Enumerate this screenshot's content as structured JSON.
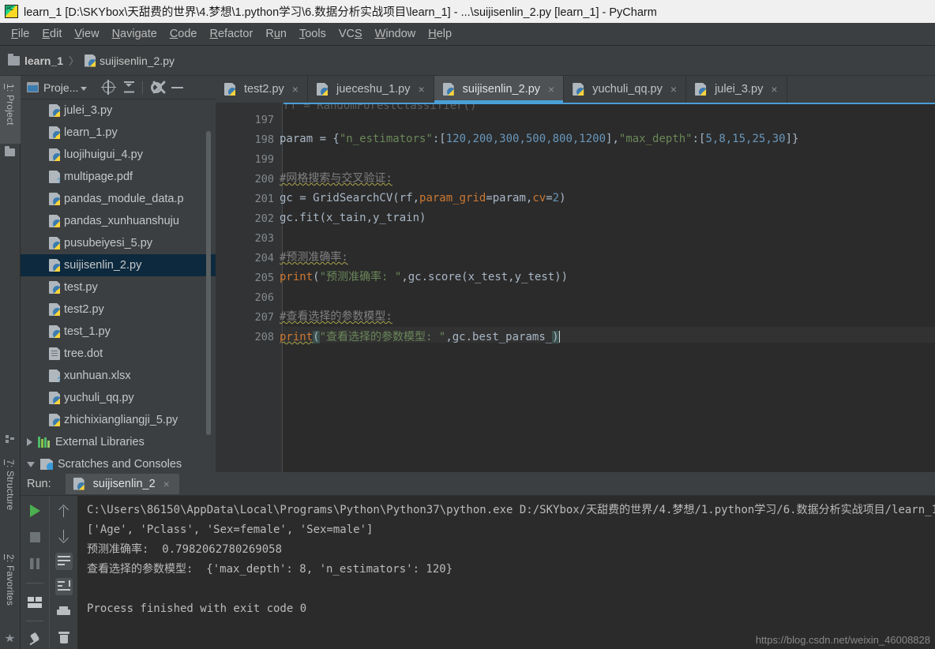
{
  "window": {
    "title": "learn_1 [D:\\SKYbox\\天甜费的世界\\4.梦想\\1.python学习\\6.数据分析实战项目\\learn_1] - ...\\suijisenlin_2.py [learn_1] - PyCharm",
    "logo_icon": "pycharm-logo-icon"
  },
  "menubar": {
    "items": [
      {
        "label": "File",
        "mnemonic": "F"
      },
      {
        "label": "Edit",
        "mnemonic": "E"
      },
      {
        "label": "View",
        "mnemonic": "V"
      },
      {
        "label": "Navigate",
        "mnemonic": "N"
      },
      {
        "label": "Code",
        "mnemonic": "C"
      },
      {
        "label": "Refactor",
        "mnemonic": "R"
      },
      {
        "label": "Run",
        "mnemonic": "u"
      },
      {
        "label": "Tools",
        "mnemonic": "T"
      },
      {
        "label": "VCS",
        "mnemonic": "S"
      },
      {
        "label": "Window",
        "mnemonic": "W"
      },
      {
        "label": "Help",
        "mnemonic": "H"
      }
    ]
  },
  "breadcrumb": {
    "separator": "〉",
    "items": [
      {
        "label": "learn_1",
        "icon": "folder-icon"
      },
      {
        "label": "suijisenlin_2.py",
        "icon": "python-file-icon"
      }
    ]
  },
  "left_strip": {
    "tabs": [
      {
        "label": "1: Project",
        "num": "1",
        "icon": "folder-icon",
        "active": true
      },
      {
        "label": "7: Structure",
        "num": "7",
        "icon": "structure-icon",
        "active": false
      },
      {
        "label": "2: Favorites",
        "num": "2",
        "icon": "star-icon",
        "active": false
      }
    ]
  },
  "project_panel": {
    "title": "Proje...",
    "toolbar": [
      {
        "name": "select-opened-file-icon",
        "glyph": "target-icon"
      },
      {
        "name": "collapse-all-icon",
        "glyph": "collapse-icon"
      },
      {
        "name": "settings-icon",
        "glyph": "gear-icon"
      },
      {
        "name": "hide-icon",
        "glyph": "minus-icon"
      }
    ],
    "tree": [
      {
        "label": "julei_3.py",
        "icon": "python-file-icon",
        "indent": 1,
        "selected": false
      },
      {
        "label": "learn_1.py",
        "icon": "python-file-icon",
        "indent": 1,
        "selected": false
      },
      {
        "label": "luojihuigui_4.py",
        "icon": "python-file-icon",
        "indent": 1,
        "selected": false
      },
      {
        "label": "multipage.pdf",
        "icon": "unknown-file-icon",
        "indent": 1,
        "selected": false
      },
      {
        "label": "pandas_module_data.p",
        "icon": "python-file-icon",
        "indent": 1,
        "selected": false
      },
      {
        "label": "pandas_xunhuanshuju",
        "icon": "python-file-icon",
        "indent": 1,
        "selected": false
      },
      {
        "label": "pusubeiyesi_5.py",
        "icon": "python-file-icon",
        "indent": 1,
        "selected": false
      },
      {
        "label": "suijisenlin_2.py",
        "icon": "python-file-icon",
        "indent": 1,
        "selected": true
      },
      {
        "label": "test.py",
        "icon": "python-file-icon",
        "indent": 1,
        "selected": false
      },
      {
        "label": "test2.py",
        "icon": "python-file-icon",
        "indent": 1,
        "selected": false
      },
      {
        "label": "test_1.py",
        "icon": "python-file-icon",
        "indent": 1,
        "selected": false
      },
      {
        "label": "tree.dot",
        "icon": "text-file-icon",
        "indent": 1,
        "selected": false
      },
      {
        "label": "xunhuan.xlsx",
        "icon": "unknown-file-icon",
        "indent": 1,
        "selected": false
      },
      {
        "label": "yuchuli_qq.py",
        "icon": "python-file-icon",
        "indent": 1,
        "selected": false
      },
      {
        "label": "zhichixiangliangji_5.py",
        "icon": "python-file-icon",
        "indent": 1,
        "selected": false
      },
      {
        "label": "External Libraries",
        "icon": "libraries-icon",
        "indent": 0,
        "selected": false,
        "arrow": "right"
      },
      {
        "label": "Scratches and Consoles",
        "icon": "scratches-icon",
        "indent": 0,
        "selected": false,
        "arrow": "down"
      }
    ]
  },
  "editor_tabs": [
    {
      "label": "test2.py",
      "icon": "python-file-icon",
      "active": false,
      "close": "×"
    },
    {
      "label": "jueceshu_1.py",
      "icon": "python-file-icon",
      "active": false,
      "close": "×"
    },
    {
      "label": "suijisenlin_2.py",
      "icon": "python-file-icon",
      "active": true,
      "close": "×"
    },
    {
      "label": "yuchuli_qq.py",
      "icon": "python-file-icon",
      "active": false,
      "close": "×"
    },
    {
      "label": "julei_3.py",
      "icon": "python-file-icon",
      "active": false,
      "close": "×"
    }
  ],
  "editor": {
    "ghost_line_top": "rf = RandomForestClassifier()",
    "line_numbers": [
      "197",
      "198",
      "199",
      "200",
      "201",
      "202",
      "203",
      "204",
      "205",
      "206",
      "207",
      "208"
    ],
    "code": {
      "l198_a": "param = {",
      "l198_str1": "\"n_estimators\"",
      "l198_b": ":[",
      "l198_nums1": "120,200,300,500,800,1200",
      "l198_c": "],",
      "l198_str2": "\"max_depth\"",
      "l198_d": ":[",
      "l198_nums2": "5,8,15,25,30",
      "l198_e": "]}",
      "l200_comment": "#网格搜索与交叉验证:",
      "l201_a": "gc = GridSearchCV(rf,",
      "l201_kw1": "param_grid",
      "l201_b": "=param,",
      "l201_kw2": "cv",
      "l201_c": "=",
      "l201_num": "2",
      "l201_d": ")",
      "l202": "gc.fit(x_tain,y_train)",
      "l204_comment": "#预测准确率:",
      "l205_fn": "print",
      "l205_a": "(",
      "l205_str": "\"预测准确率: \"",
      "l205_b": ",gc.score(x_test,y_test))",
      "l207_comment": "#查看选择的参数模型:",
      "l208_fn": "print",
      "l208_paren_open": "(",
      "l208_str": "\"查看选择的参数模型: \"",
      "l208_b": ",gc.best_params_",
      "l208_paren_close": ")"
    }
  },
  "run_panel": {
    "label": "Run:",
    "tab": {
      "label": "suijisenlin_2",
      "icon": "python-file-icon",
      "close": "×"
    },
    "toolbar_left": [
      {
        "name": "rerun-button",
        "icon": "play-icon"
      },
      {
        "name": "stop-button",
        "icon": "stop-icon"
      },
      {
        "name": "pause-button",
        "icon": "pause-icon"
      },
      {
        "name": "layout-button",
        "icon": "layout-icon"
      },
      {
        "name": "pin-tab-button",
        "icon": "pin-icon"
      }
    ],
    "toolbar_right": [
      {
        "name": "up-the-stack-trace-button",
        "icon": "arrow-up-icon"
      },
      {
        "name": "down-the-stack-trace-button",
        "icon": "arrow-down-icon"
      },
      {
        "name": "soft-wrap-button",
        "icon": "wrap-icon",
        "active": true
      },
      {
        "name": "scroll-to-end-button",
        "icon": "scroll-end-icon",
        "active": true
      },
      {
        "name": "print-button",
        "icon": "print-icon"
      },
      {
        "name": "clear-all-button",
        "icon": "trash-icon"
      }
    ],
    "console_lines": [
      "C:\\Users\\86150\\AppData\\Local\\Programs\\Python\\Python37\\python.exe D:/SKYbox/天甜费的世界/4.梦想/1.python学习/6.数据分析实战项目/learn_1",
      "['Age', 'Pclass', 'Sex=female', 'Sex=male']",
      "预测准确率:  0.7982062780269058",
      "查看选择的参数模型:  {'max_depth': 8, 'n_estimators': 120}",
      "",
      "Process finished with exit code 0"
    ]
  },
  "watermark": "https://blog.csdn.net/weixin_46008828",
  "colors": {
    "accent": "#4a9fd8",
    "panel_bg": "#3c3f41",
    "editor_bg": "#2b2b2b",
    "selection": "#0d293e",
    "string_green": "#6a8759",
    "keyword_orange": "#cc7832",
    "number_blue": "#6897bb",
    "comment_grey": "#808080"
  }
}
